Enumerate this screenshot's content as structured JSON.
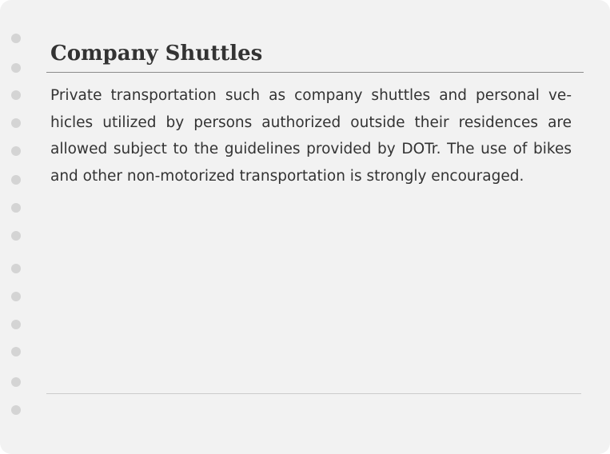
{
  "section": {
    "title": "Company Shuttles",
    "body": "Private transportation such as company shuttles and personal ve­hicles utilized by persons authorized outside their residences are allowed subject to the guidelines provided by DOTr. The use of bikes and other non-motorized transportation is strongly encour­aged."
  },
  "colors": {
    "background": "#f2f2f2",
    "text": "#333333",
    "rule": "#8c8c8c",
    "hole": "#d4d4d4"
  }
}
